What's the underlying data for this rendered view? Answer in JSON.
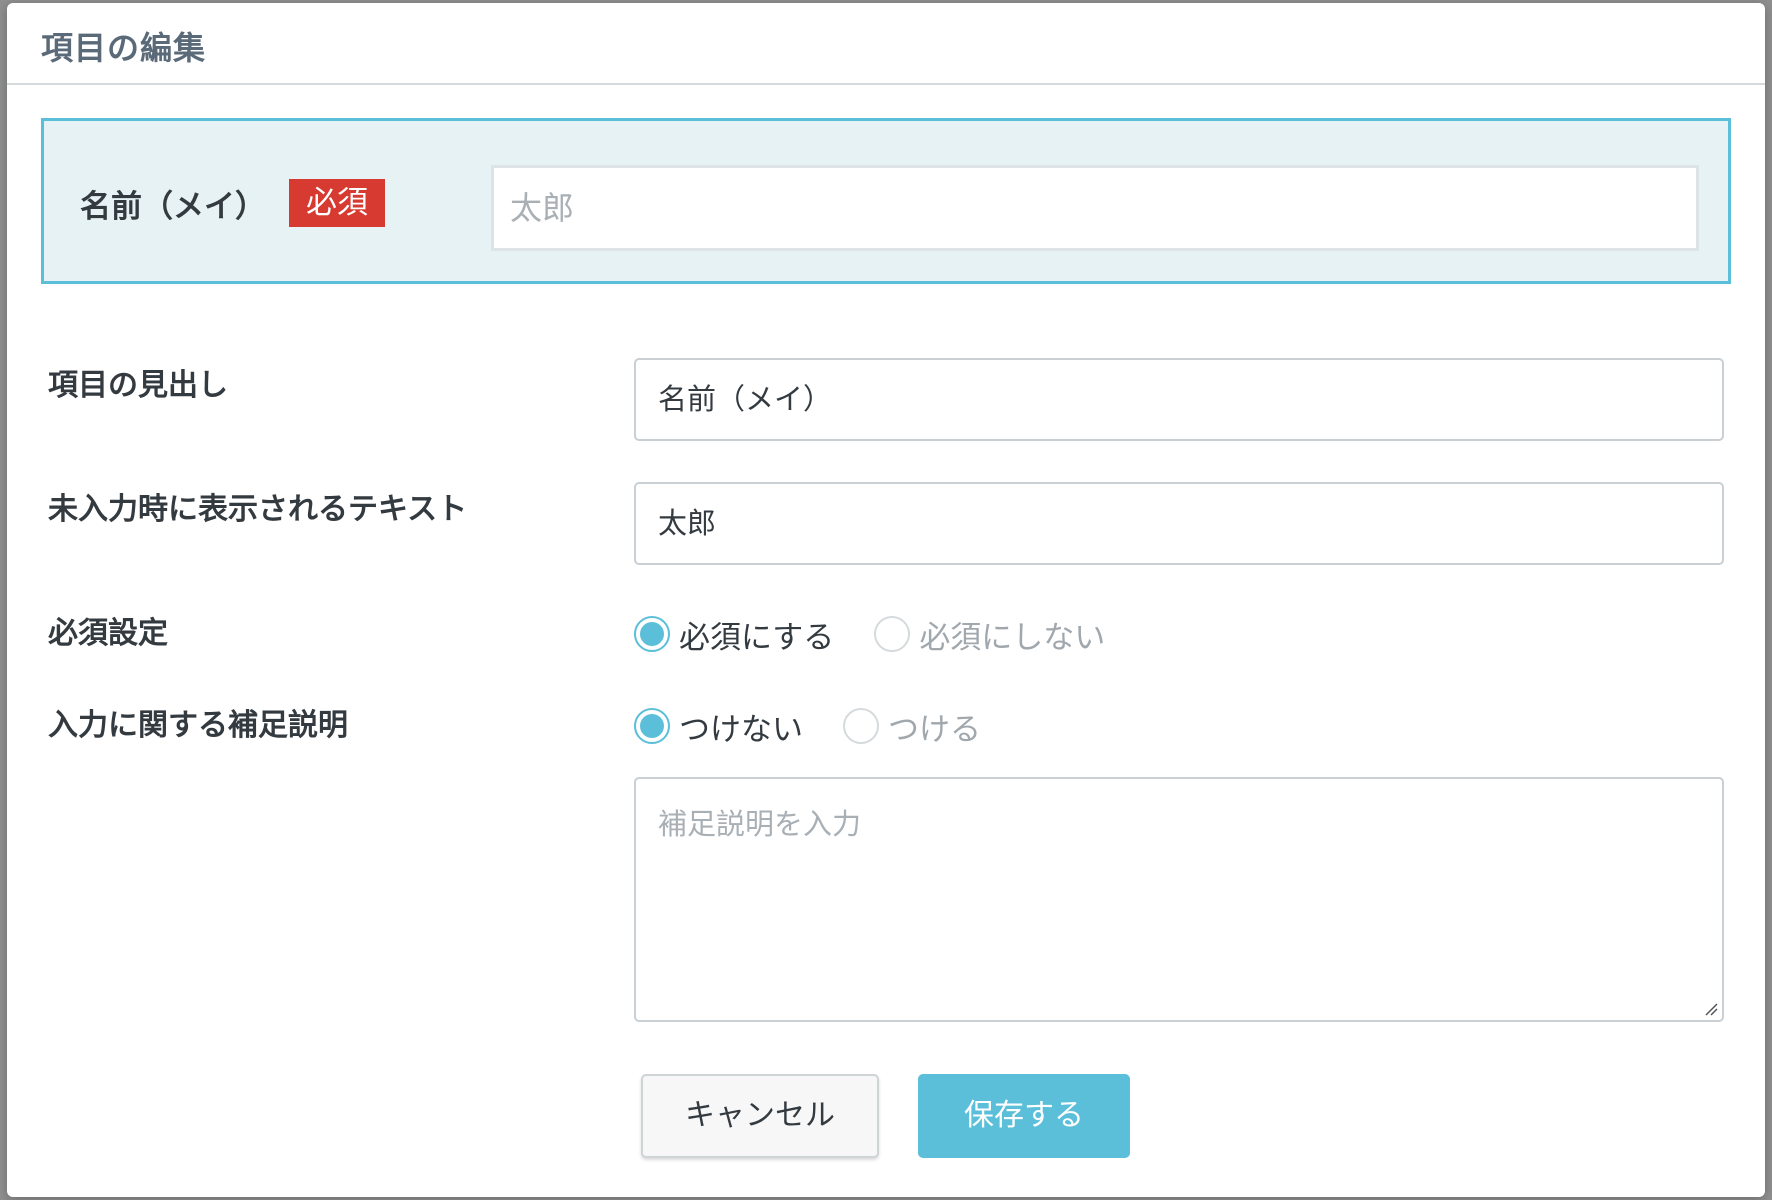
{
  "dialog": {
    "title": "項目の編集"
  },
  "preview": {
    "label": "名前（メイ）",
    "required_badge": "必須",
    "placeholder": "太郎"
  },
  "form": {
    "heading_label": "項目の見出し",
    "heading_value": "名前（メイ）",
    "placeholder_label": "未入力時に表示されるテキスト",
    "placeholder_value": "太郎",
    "required_label": "必須設定",
    "required_options": [
      {
        "label": "必須にする",
        "checked": true
      },
      {
        "label": "必須にしない",
        "checked": false
      }
    ],
    "note_label": "入力に関する補足説明",
    "note_options": [
      {
        "label": "つけない",
        "checked": true
      },
      {
        "label": "つける",
        "checked": false
      }
    ],
    "note_placeholder": "補足説明を入力"
  },
  "buttons": {
    "cancel": "キャンセル",
    "save": "保存する"
  },
  "colors": {
    "accent": "#5bbfd9",
    "required_badge": "#d63a30",
    "preview_bg": "#e6f2f4"
  }
}
